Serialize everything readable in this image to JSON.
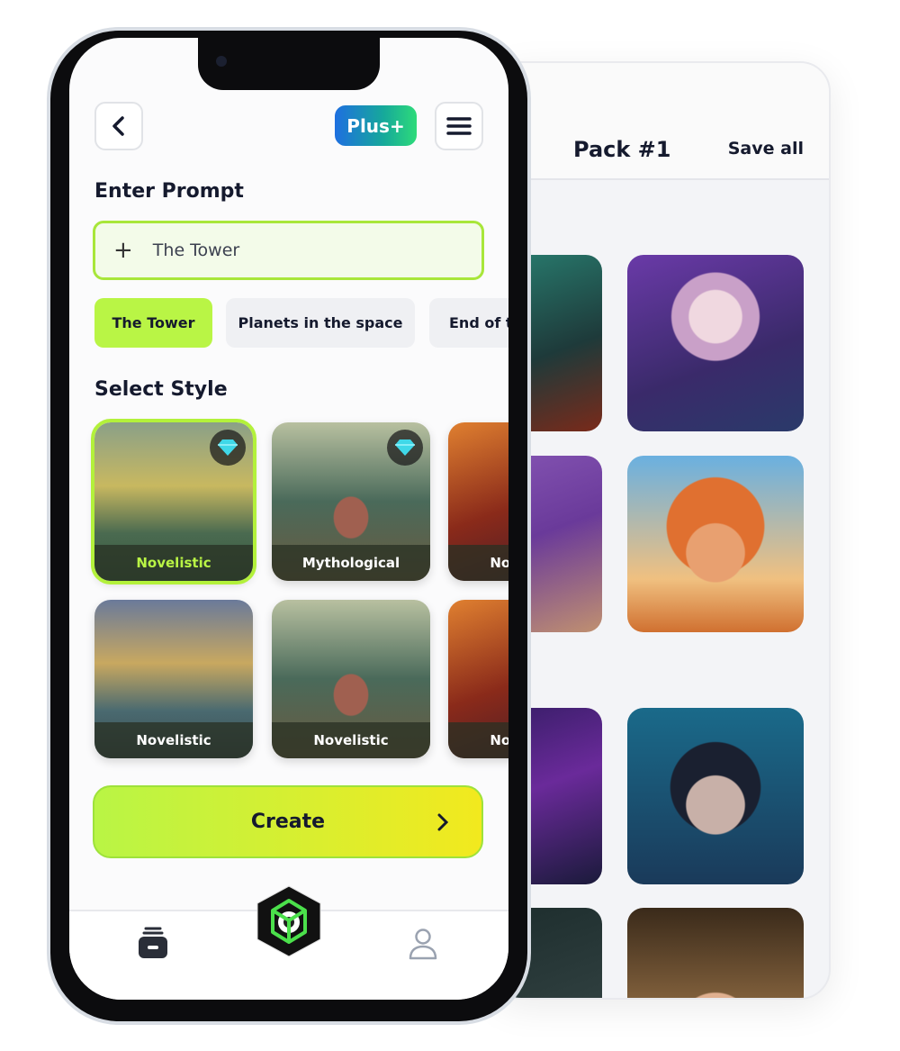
{
  "pack": {
    "title": "Pack #1",
    "save_all": "Save all"
  },
  "header": {
    "plus_label": "Plus+"
  },
  "prompt": {
    "heading": "Enter Prompt",
    "value": "The Tower"
  },
  "chips": [
    {
      "label": "The Tower",
      "active": true
    },
    {
      "label": "Planets in the space"
    },
    {
      "label": "End of the world"
    }
  ],
  "style": {
    "heading": "Select Style",
    "tiles": [
      {
        "label": "Novelistic",
        "selected": true,
        "premium": true
      },
      {
        "label": "Mythological",
        "premium": true
      },
      {
        "label": "Novelistic"
      },
      {
        "label": "Novelistic"
      },
      {
        "label": "Novelistic"
      },
      {
        "label": "Novelistic"
      }
    ]
  },
  "create_label": "Create",
  "colors": {
    "accent": "#b9f545",
    "dark": "#151a2e"
  },
  "icons": {
    "back": "chevron-left-icon",
    "menu": "hamburger-icon",
    "nav_left": "stack-icon",
    "nav_center": "cube-logo-icon",
    "nav_right": "user-icon"
  }
}
